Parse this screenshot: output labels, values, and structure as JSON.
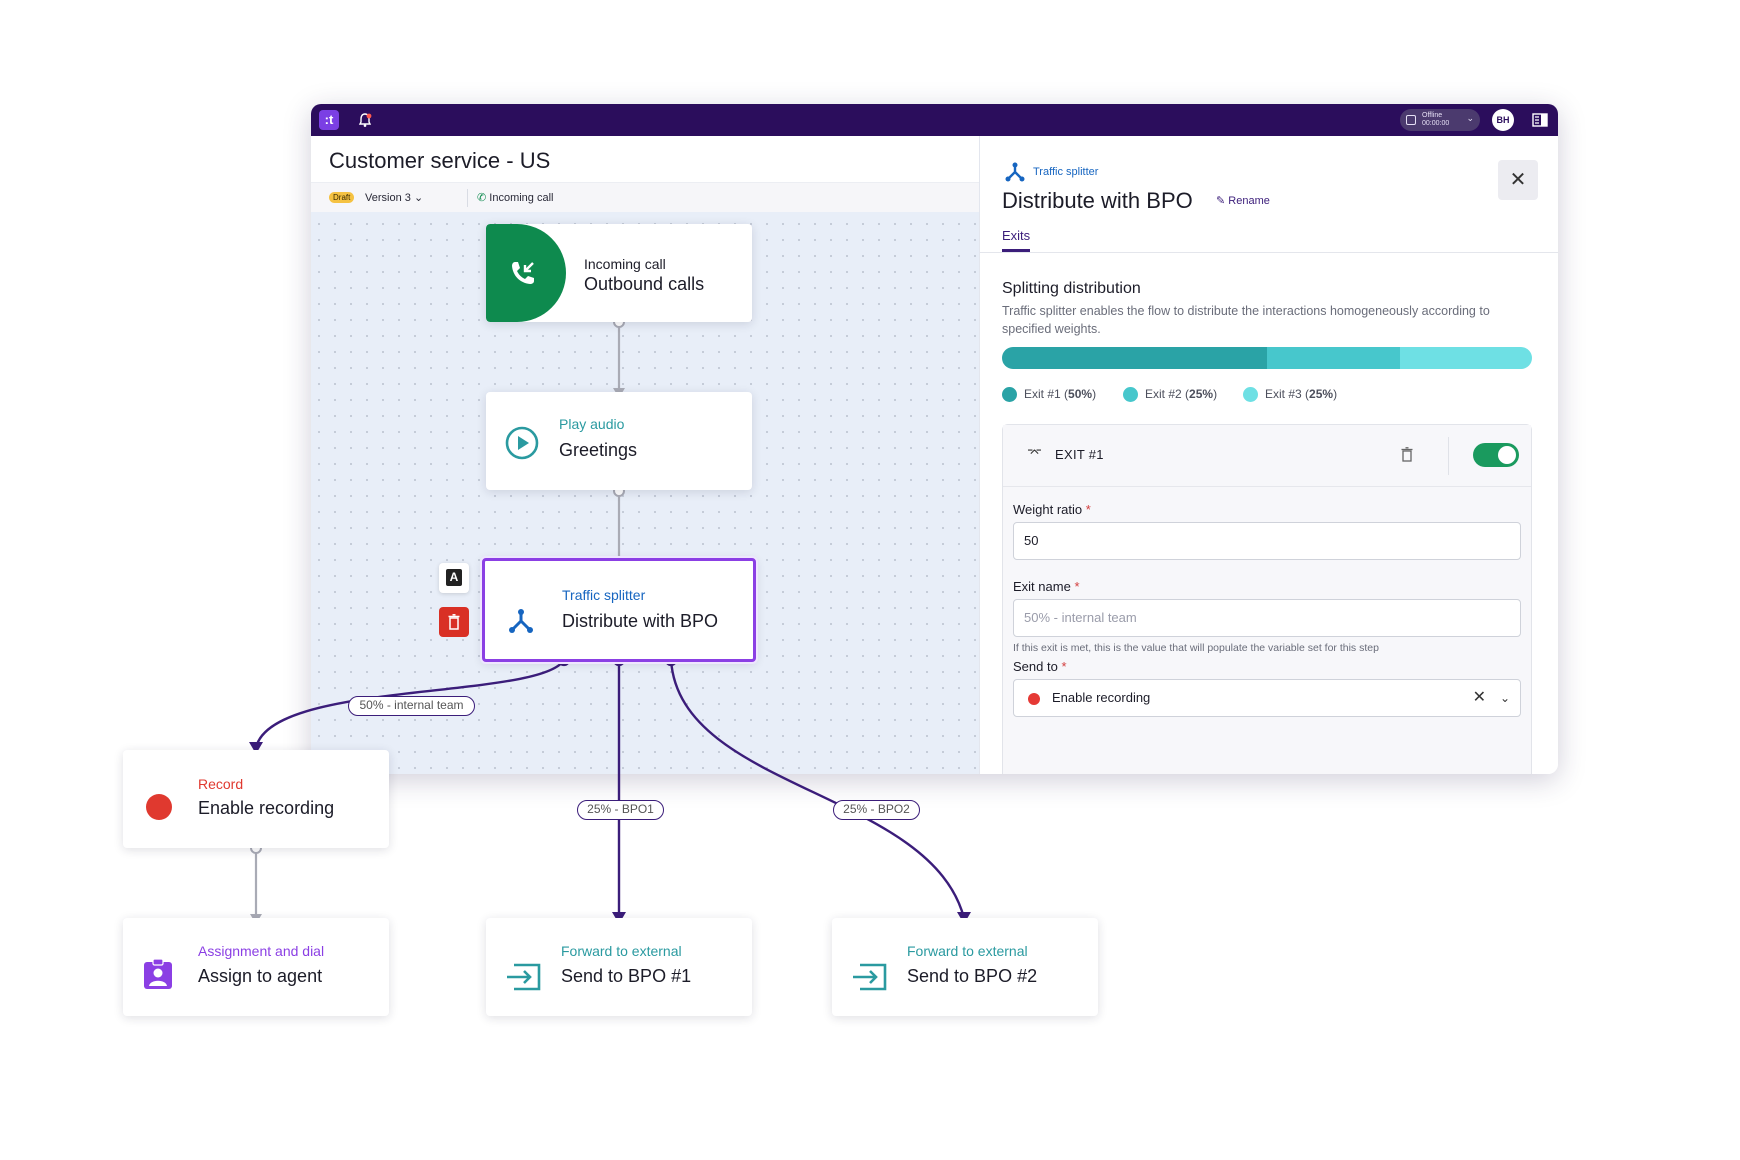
{
  "window": {
    "logo_label": ":t",
    "status": {
      "state": "Offline",
      "timer": "00:00:00"
    },
    "avatar_initials": "BH"
  },
  "page": {
    "title": "Customer service - US",
    "draft_badge": "Draft",
    "version_label": "Version 3",
    "entry_label": "Incoming call"
  },
  "panel": {
    "type_label": "Traffic splitter",
    "title": "Distribute with BPO",
    "rename_label": "Rename",
    "close_icon": "close-icon",
    "tab_label": "Exits",
    "section_title": "Splitting distribution",
    "section_desc": "Traffic splitter enables the flow to distribute the interactions homogeneously according to specified weights.",
    "distribution": [
      {
        "label": "Exit #1",
        "pct_text": "50%",
        "value": 50,
        "color": "#2aa3a6"
      },
      {
        "label": "Exit #2",
        "pct_text": "25%",
        "value": 25,
        "color": "#47c7cc"
      },
      {
        "label": "Exit #3",
        "pct_text": "25%",
        "value": 25,
        "color": "#6ee0e4"
      }
    ],
    "exit": {
      "title": "EXIT #1",
      "enabled": true,
      "weight_label": "Weight ratio",
      "weight_value": "50",
      "name_label": "Exit name",
      "name_placeholder": "50% - internal team",
      "name_hint": "If this exit is met, this is the value that will populate the variable set for this step",
      "send_label": "Send to",
      "send_value": "Enable recording",
      "required_mark": "*"
    }
  },
  "nodes": {
    "incoming": {
      "type": "Incoming call",
      "name": "Outbound calls",
      "icon": "incoming-call-icon",
      "color": "#0e8a4e"
    },
    "play_audio": {
      "type": "Play audio",
      "name": "Greetings",
      "icon": "play-circle-icon",
      "color": "#2a9aa0"
    },
    "splitter": {
      "type": "Traffic splitter",
      "name": "Distribute with BPO",
      "icon": "traffic-splitter-icon",
      "color": "#1665c0",
      "side_actions": [
        "A",
        "delete"
      ]
    },
    "record": {
      "type": "Record",
      "name": "Enable recording",
      "icon": "record-dot-icon",
      "color": "#e0392f"
    },
    "assign": {
      "type": "Assignment and dial",
      "name": "Assign to agent",
      "icon": "agent-badge-icon",
      "color": "#8b3fe4"
    },
    "bpo1": {
      "type": "Forward to external",
      "name": "Send to BPO #1",
      "icon": "forward-external-icon",
      "color": "#2a9aa0"
    },
    "bpo2": {
      "type": "Forward to external",
      "name": "Send to BPO #2",
      "icon": "forward-external-icon",
      "color": "#2a9aa0"
    }
  },
  "edges": {
    "exit1_label": "50% - internal team",
    "exit2_label": "25% - BPO1",
    "exit3_label": "25% - BPO2",
    "accent": "#3b1d7a"
  }
}
